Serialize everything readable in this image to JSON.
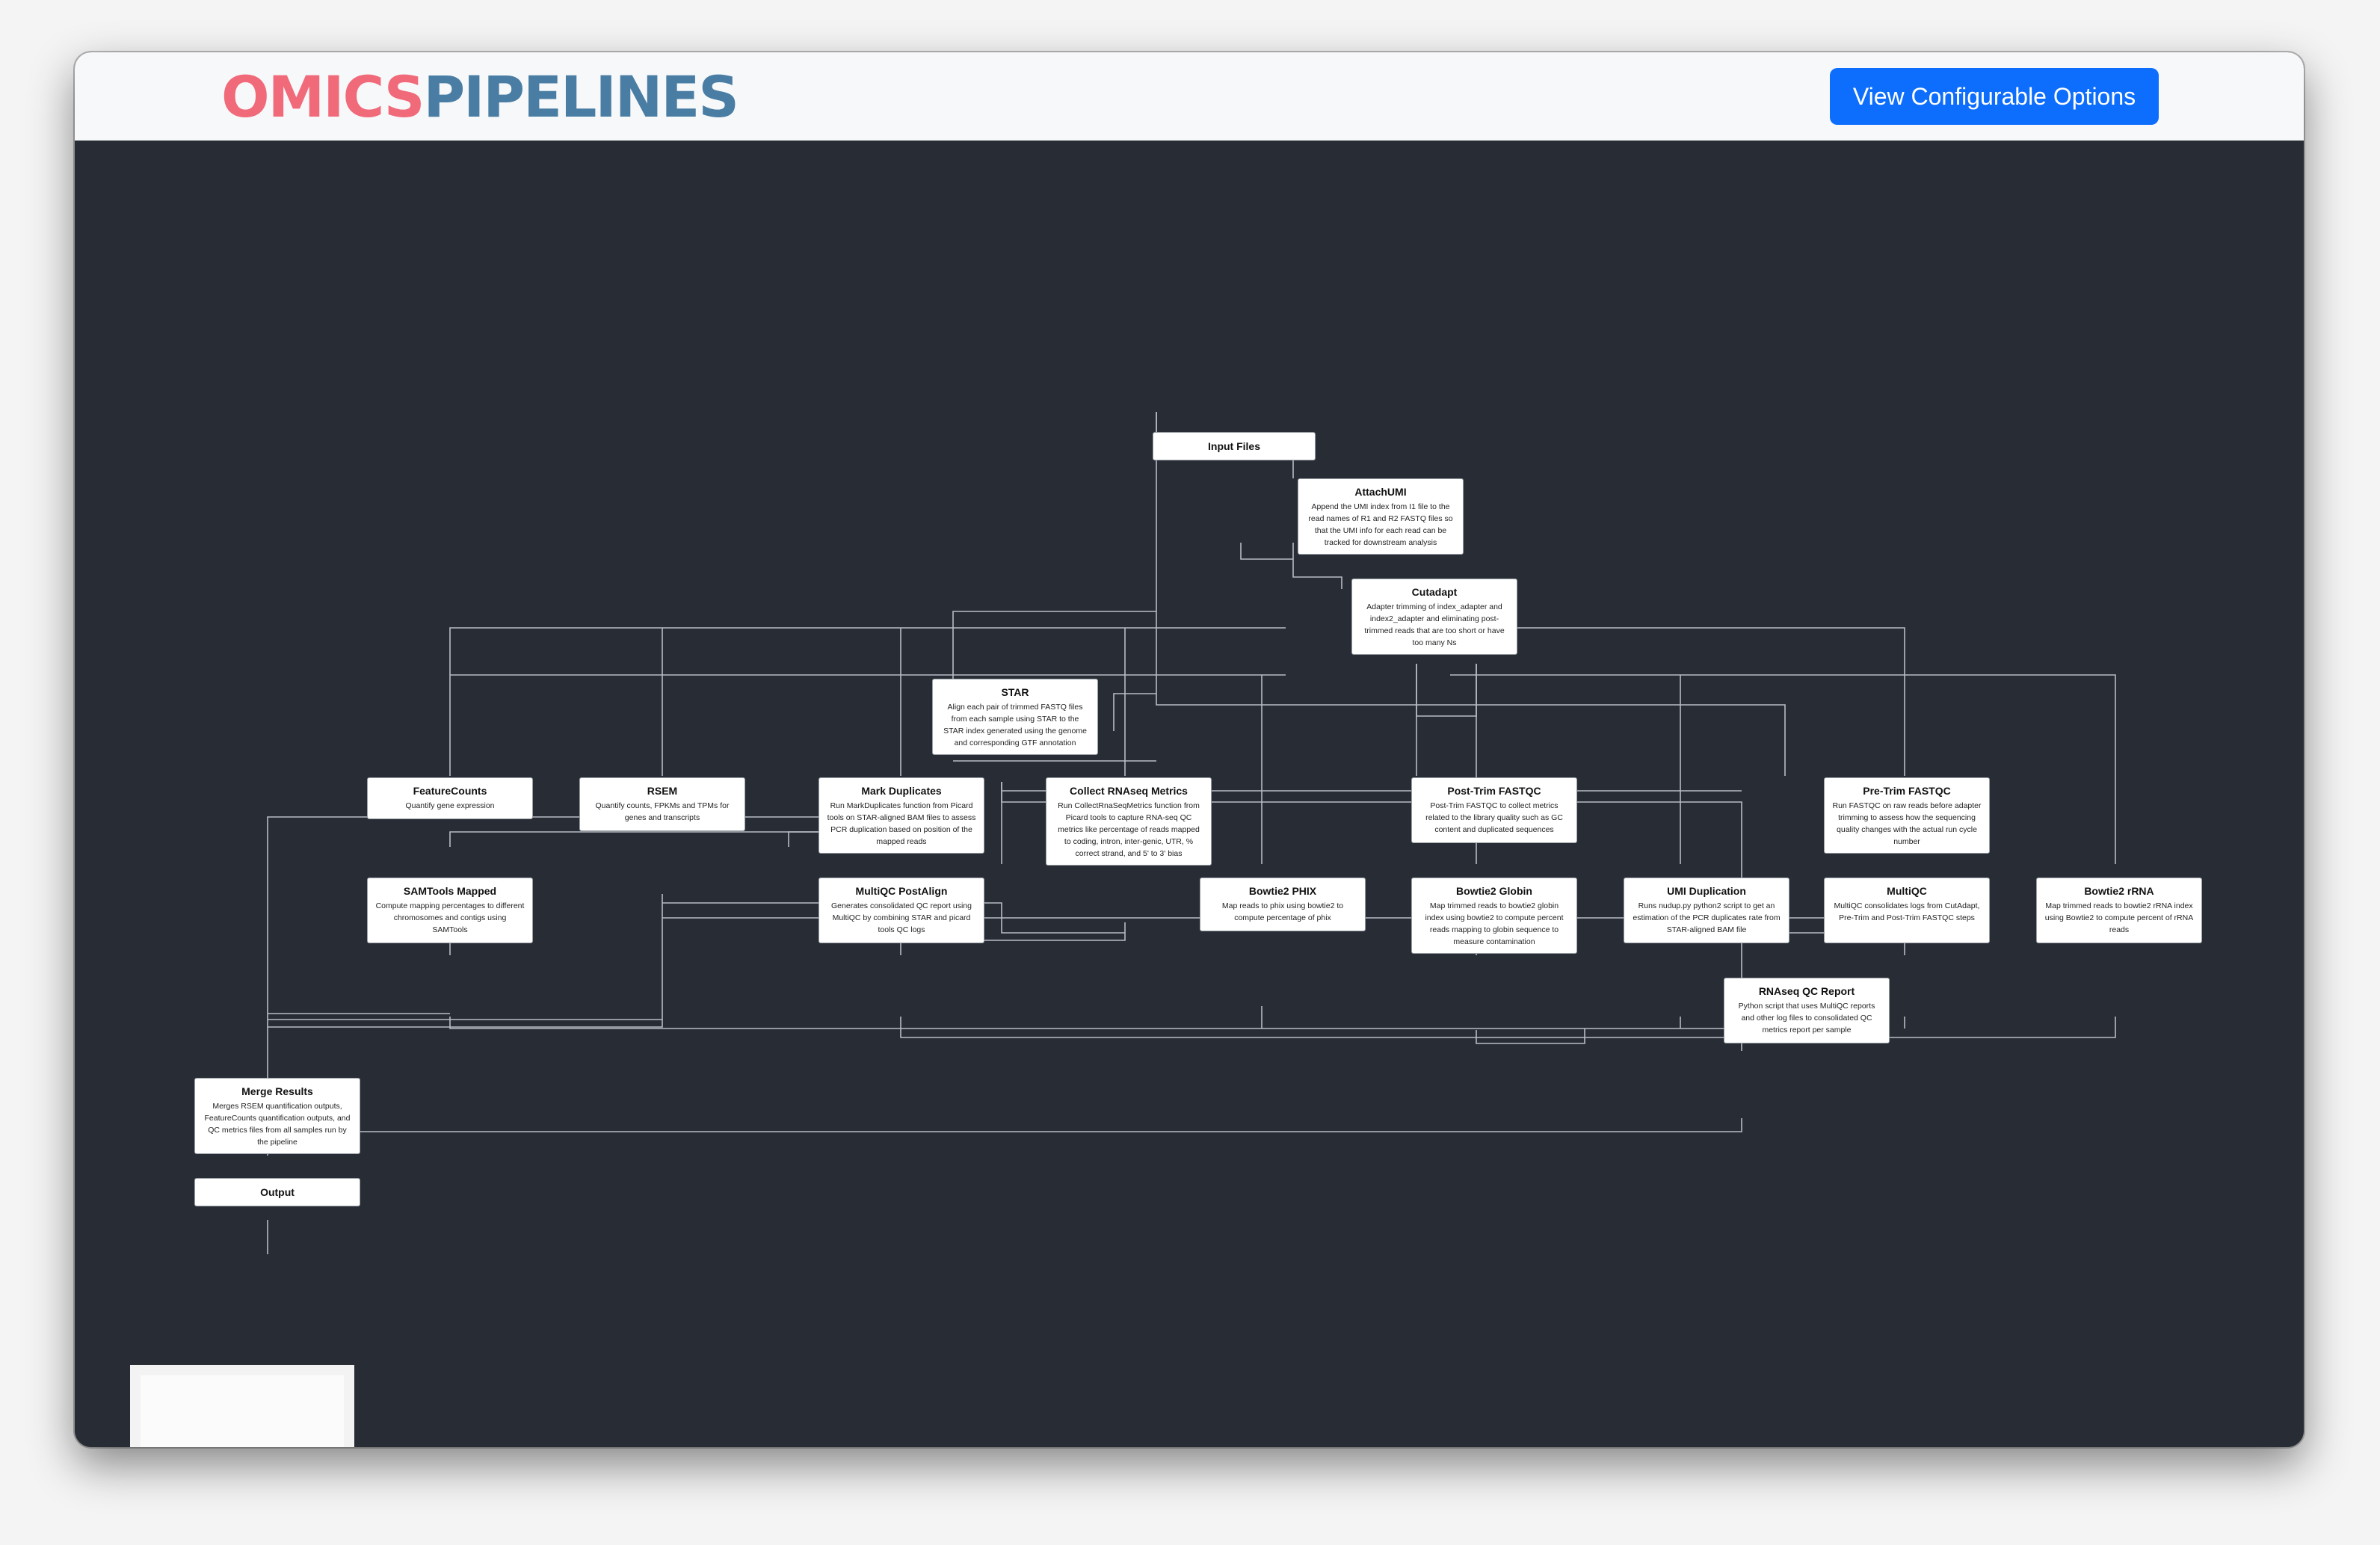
{
  "header": {
    "logo_part1": "OMICS",
    "logo_part2": "PIPELINES",
    "configure_button": "View Configurable Options"
  },
  "colors": {
    "logo_primary": "#f06a7a",
    "logo_secondary": "#4a7da3",
    "button": "#0d6efd",
    "canvas_background": "#272c35",
    "edge": "#b8bcc4"
  },
  "nodes": {
    "input_files": {
      "title": "Input Files"
    },
    "attachumi": {
      "title": "AttachUMI",
      "desc": "Append the UMI index from I1 file to the read names of R1 and R2 FASTQ files so that the UMI info for each read can be tracked for downstream analysis"
    },
    "cutadapt": {
      "title": "Cutadapt",
      "desc": "Adapter trimming of index_adapter and index2_adapter and eliminating post-trimmed reads that are too short or have too many Ns"
    },
    "star": {
      "title": "STAR",
      "desc": "Align each pair of trimmed FASTQ files from each sample using STAR to the STAR index generated using the genome and corresponding GTF annotation"
    },
    "featurecounts": {
      "title": "FeatureCounts",
      "desc": "Quantify gene expression"
    },
    "rsem": {
      "title": "RSEM",
      "desc": "Quantify counts, FPKMs and TPMs for genes and transcripts"
    },
    "mark_duplicates": {
      "title": "Mark Duplicates",
      "desc": "Run MarkDuplicates function from Picard tools on STAR-aligned BAM files to assess PCR duplication based on position of the mapped reads"
    },
    "collect_rnaseq_metrics": {
      "title": "Collect RNAseq Metrics",
      "desc": "Run CollectRnaSeqMetrics function from Picard tools to capture RNA-seq QC metrics like percentage of reads mapped to coding, intron, inter-genic, UTR, % correct strand, and 5' to 3' bias"
    },
    "post_trim_fastqc": {
      "title": "Post-Trim FASTQC",
      "desc": "Post-Trim FASTQC to collect metrics related to the library quality such as GC content and duplicated sequences"
    },
    "pre_trim_fastqc": {
      "title": "Pre-Trim FASTQC",
      "desc": "Run FASTQC on raw reads before adapter trimming to assess how the sequencing quality changes with the actual run cycle number"
    },
    "samtools_mapped": {
      "title": "SAMTools Mapped",
      "desc": "Compute mapping percentages to different chromosomes and contigs using SAMTools"
    },
    "multiqc_postalign": {
      "title": "MultiQC PostAlign",
      "desc": "Generates consolidated QC report using MultiQC by combining STAR and picard tools QC logs"
    },
    "bowtie2_phix": {
      "title": "Bowtie2 PHIX",
      "desc": "Map reads to phix using bowtie2 to compute percentage of phix"
    },
    "bowtie2_globin": {
      "title": "Bowtie2 Globin",
      "desc": "Map trimmed reads to bowtie2 globin index using bowtie2 to compute percent reads mapping to globin sequence to measure contamination"
    },
    "umi_duplication": {
      "title": "UMI Duplication",
      "desc": "Runs nudup.py python2 script to get an estimation of the PCR duplicates rate from STAR-aligned BAM file"
    },
    "multiqc": {
      "title": "MultiQC",
      "desc": "MultiQC consolidates logs from CutAdapt, Pre-Trim and Post-Trim FASTQC steps"
    },
    "bowtie2_rrna": {
      "title": "Bowtie2 rRNA",
      "desc": "Map trimmed reads to bowtie2 rRNA index using Bowtie2 to compute percent of rRNA reads"
    },
    "rnaseq_qc_report": {
      "title": "RNAseq QC Report",
      "desc": "Python script that uses MultiQC reports and other log files to consolidated QC metrics report per sample"
    },
    "merge_results": {
      "title": "Merge Results",
      "desc": "Merges RSEM quantification outputs, FeatureCounts quantification outputs, and QC metrics files from all samples run by the pipeline"
    },
    "output": {
      "title": "Output"
    }
  }
}
